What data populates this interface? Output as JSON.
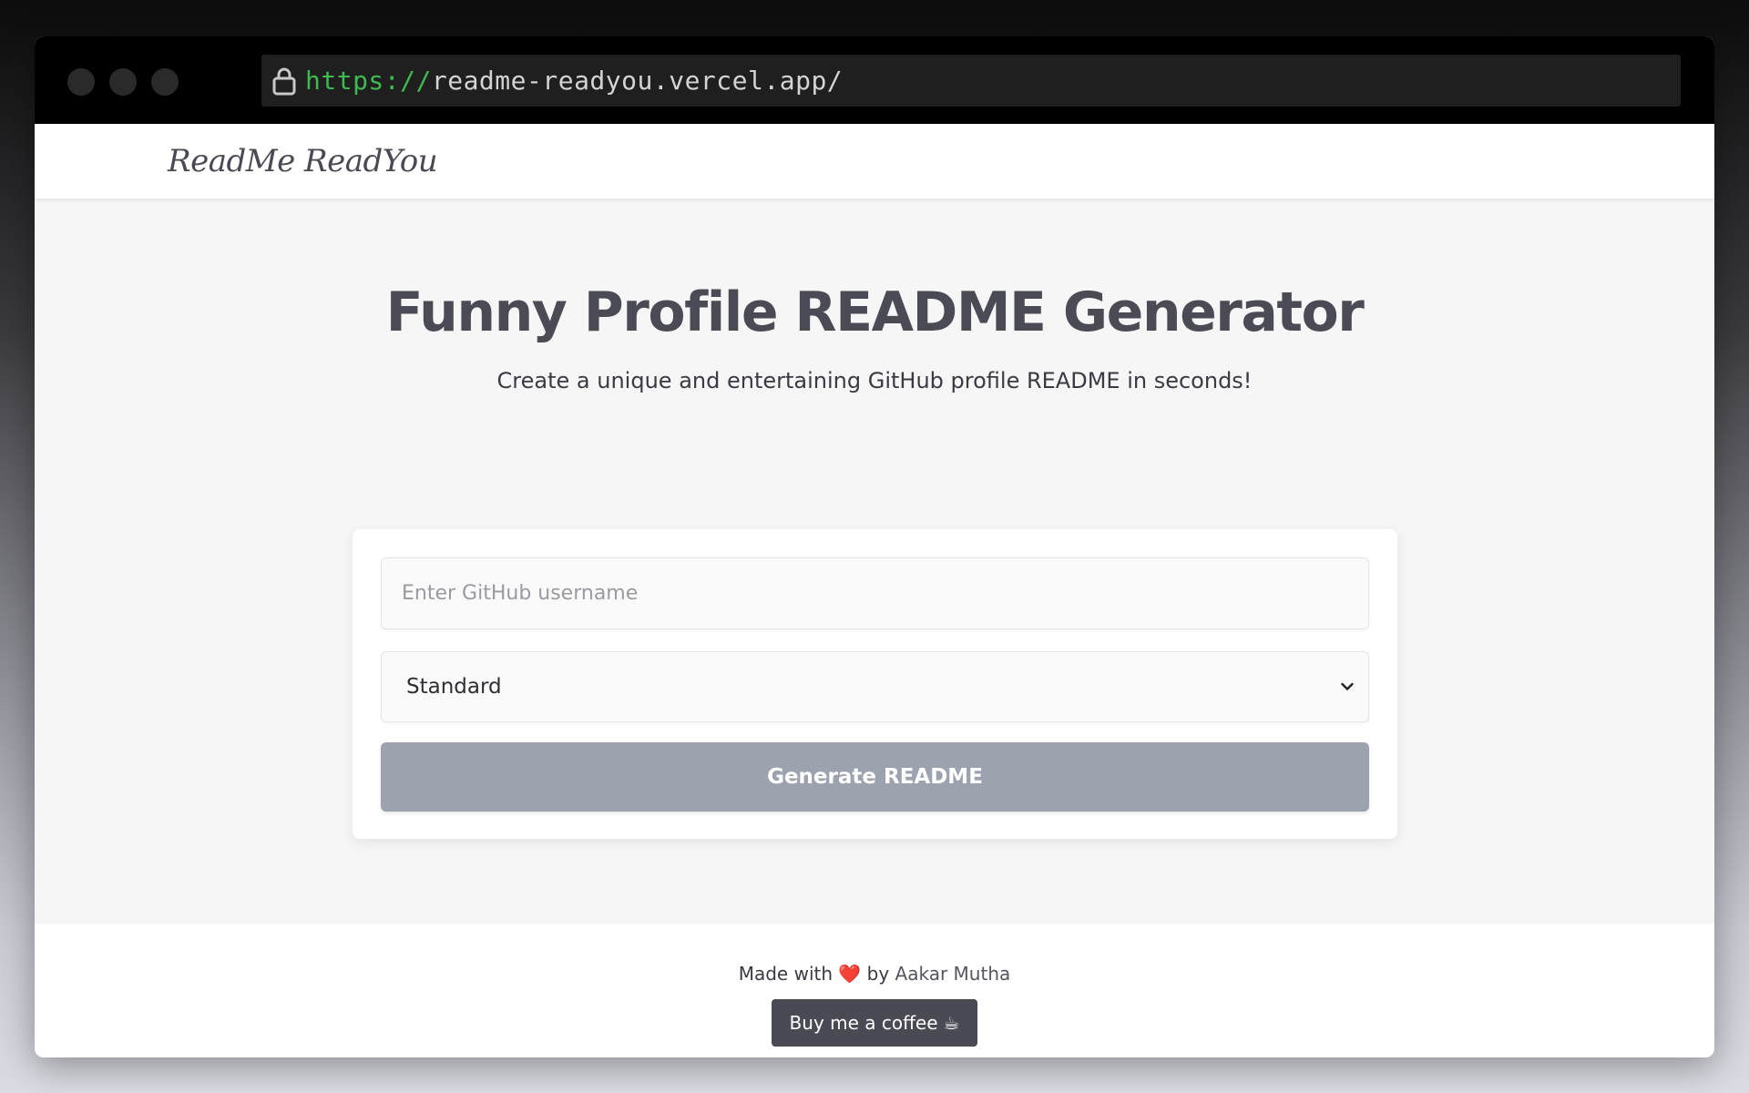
{
  "browser": {
    "url_scheme": "https://",
    "url_rest": "readme-readyou.vercel.app/"
  },
  "navbar": {
    "brand": "ReadMe ReadYou"
  },
  "hero": {
    "title": "Funny Profile README Generator",
    "subtitle": "Create a unique and entertaining GitHub profile README in seconds!"
  },
  "form": {
    "username_placeholder": "Enter GitHub username",
    "username_value": "",
    "style_selected": "Standard",
    "generate_label": "Generate README"
  },
  "footer": {
    "made_prefix": "Made with",
    "heart": "❤️",
    "made_by": "by",
    "author": "Aakar Mutha",
    "coffee_label": "Buy me a coffee",
    "coffee_icon": "☕"
  },
  "colors": {
    "button_disabled": "#9ca3ae",
    "coffee_button": "#4a4a55",
    "scheme_green": "#3fb950"
  }
}
